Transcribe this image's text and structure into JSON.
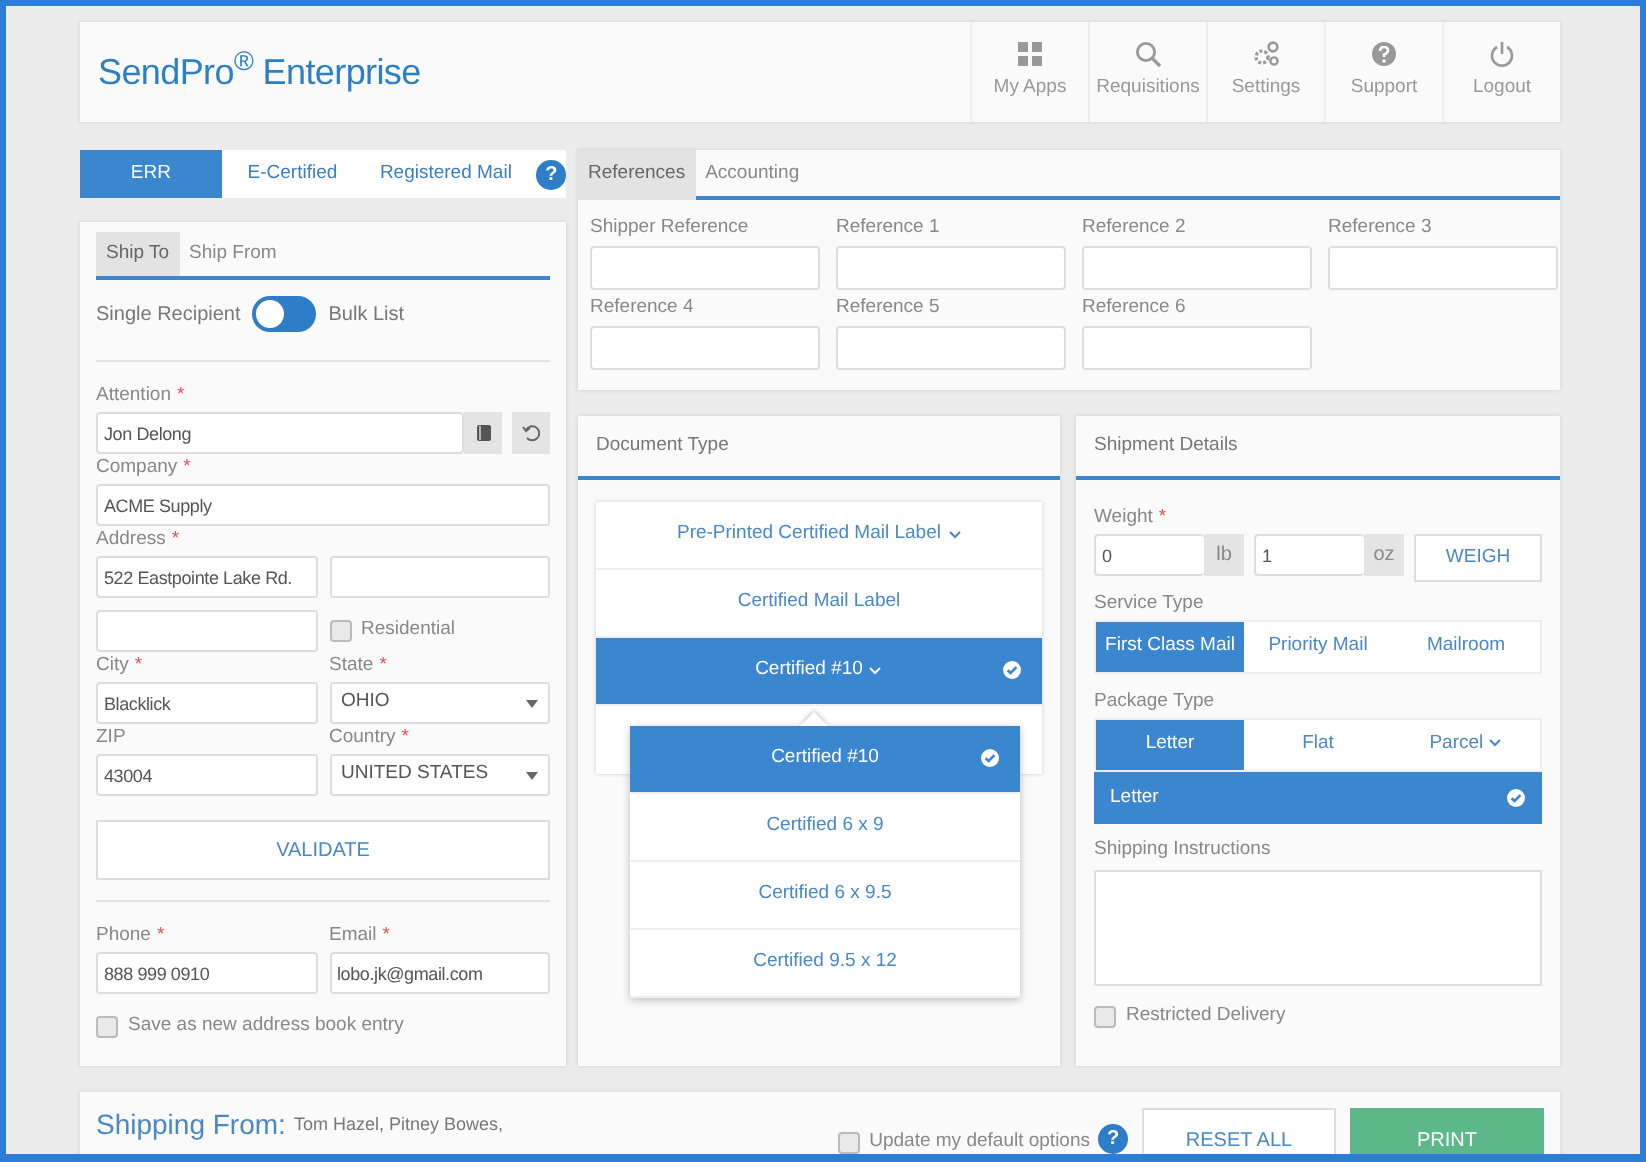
{
  "header": {
    "logo": "SendPro$^{®}$ Enterprise",
    "nav": [
      {
        "kind": "apps",
        "label": "My Apps"
      },
      {
        "kind": "search",
        "label": "Requisitions"
      },
      {
        "kind": "settings",
        "label": "Settings"
      },
      {
        "kind": "help",
        "label": "Support"
      },
      {
        "kind": "power",
        "label": "Logout"
      }
    ]
  },
  "mail_tabs": [
    {
      "label": "ERR",
      "selected": true
    },
    {
      "label": "E-Certified",
      "selected": false
    },
    {
      "label": "Registered Mail",
      "selected": false
    }
  ],
  "mail_help": "?",
  "ship_tabs": [
    {
      "label": "Ship To",
      "selected": true
    },
    {
      "label": "Ship From",
      "selected": false
    }
  ],
  "recipient_toggle": {
    "left_label": "Single Recipient",
    "right_label": "Bulk List",
    "on": false
  },
  "attention": {
    "label": "Attention",
    "mark": "*",
    "value": "Jon Delong"
  },
  "company": {
    "label": "Company",
    "mark": "*",
    "value": "ACME Supply"
  },
  "address": {
    "label": "Address",
    "mark": "*",
    "value": "522 Eastpointe Lake Rd."
  },
  "residential": {
    "label": "Residential",
    "checked": false
  },
  "city": {
    "label": "City",
    "mark": "*",
    "value": "Blacklick"
  },
  "state": {
    "label": "State",
    "mark": "*",
    "value": "OHIO"
  },
  "zip": {
    "label": "ZIP",
    "value": "43004"
  },
  "country": {
    "label": "Country",
    "mark": "*",
    "value": "UNITED STATES"
  },
  "validate_button": "VALIDATE",
  "phone": {
    "label": "Phone",
    "mark": "*",
    "value": "888 999 0910"
  },
  "email": {
    "label": "Email",
    "mark": "*",
    "value": "lobo.jk@gmail.com"
  },
  "save_entry": {
    "label": "Save as new address book entry",
    "checked": false
  },
  "references": {
    "tabs": [
      {
        "label": "References",
        "selected": true
      },
      {
        "label": "Accounting",
        "selected": false
      }
    ],
    "fields": [
      {
        "label": "Shipper Reference"
      },
      {
        "label": "Reference 1"
      },
      {
        "label": "Reference 2"
      },
      {
        "label": "Reference 3"
      },
      {
        "label": "Reference 4"
      },
      {
        "label": "Reference 5"
      },
      {
        "label": "Reference 6"
      }
    ]
  },
  "document_type": {
    "title": "Document Type",
    "options": [
      {
        "label": "Pre-Printed Certified Mail Label",
        "has_menu": true,
        "selected": false
      },
      {
        "label": "Certified Mail Label",
        "has_menu": false,
        "selected": false
      },
      {
        "label": "Certified #10",
        "has_menu": true,
        "selected": true
      }
    ],
    "menu": [
      {
        "label": "Certified #10",
        "selected": true
      },
      {
        "label": "Certified 6 x 9",
        "selected": false
      },
      {
        "label": "Certified 6 x 9.5",
        "selected": false
      },
      {
        "label": "Certified 9.5 x 12",
        "selected": false
      }
    ]
  },
  "shipment": {
    "title": "Shipment Details",
    "weight": {
      "label": "Weight",
      "mark": "*",
      "pounds": "0",
      "pounds_unit": "lb",
      "ounces": "1",
      "ounces_unit": "oz",
      "button": "WEIGH"
    },
    "service_type": {
      "label": "Service Type",
      "options": [
        {
          "label": "First Class Mail",
          "selected": true
        },
        {
          "label": "Priority Mail",
          "selected": false
        },
        {
          "label": "Mailroom",
          "selected": false
        }
      ]
    },
    "package_type": {
      "label": "Package Type",
      "options": [
        {
          "label": "Letter",
          "selected": true,
          "has_menu": false
        },
        {
          "label": "Flat",
          "selected": false,
          "has_menu": false
        },
        {
          "label": "Parcel",
          "selected": false,
          "has_menu": true
        }
      ],
      "selection": "Letter"
    },
    "instructions": {
      "label": "Shipping Instructions"
    },
    "restricted": {
      "label": "Restricted Delivery",
      "checked": false
    }
  },
  "footer": {
    "shipping_from_label": "Shipping From:",
    "shipping_from": "Tom Hazel, Pitney Bowes,",
    "update_defaults": {
      "label": "Update my default options",
      "checked": false
    },
    "help": "?",
    "reset_button": "RESET ALL",
    "print_button": "PRINT"
  }
}
